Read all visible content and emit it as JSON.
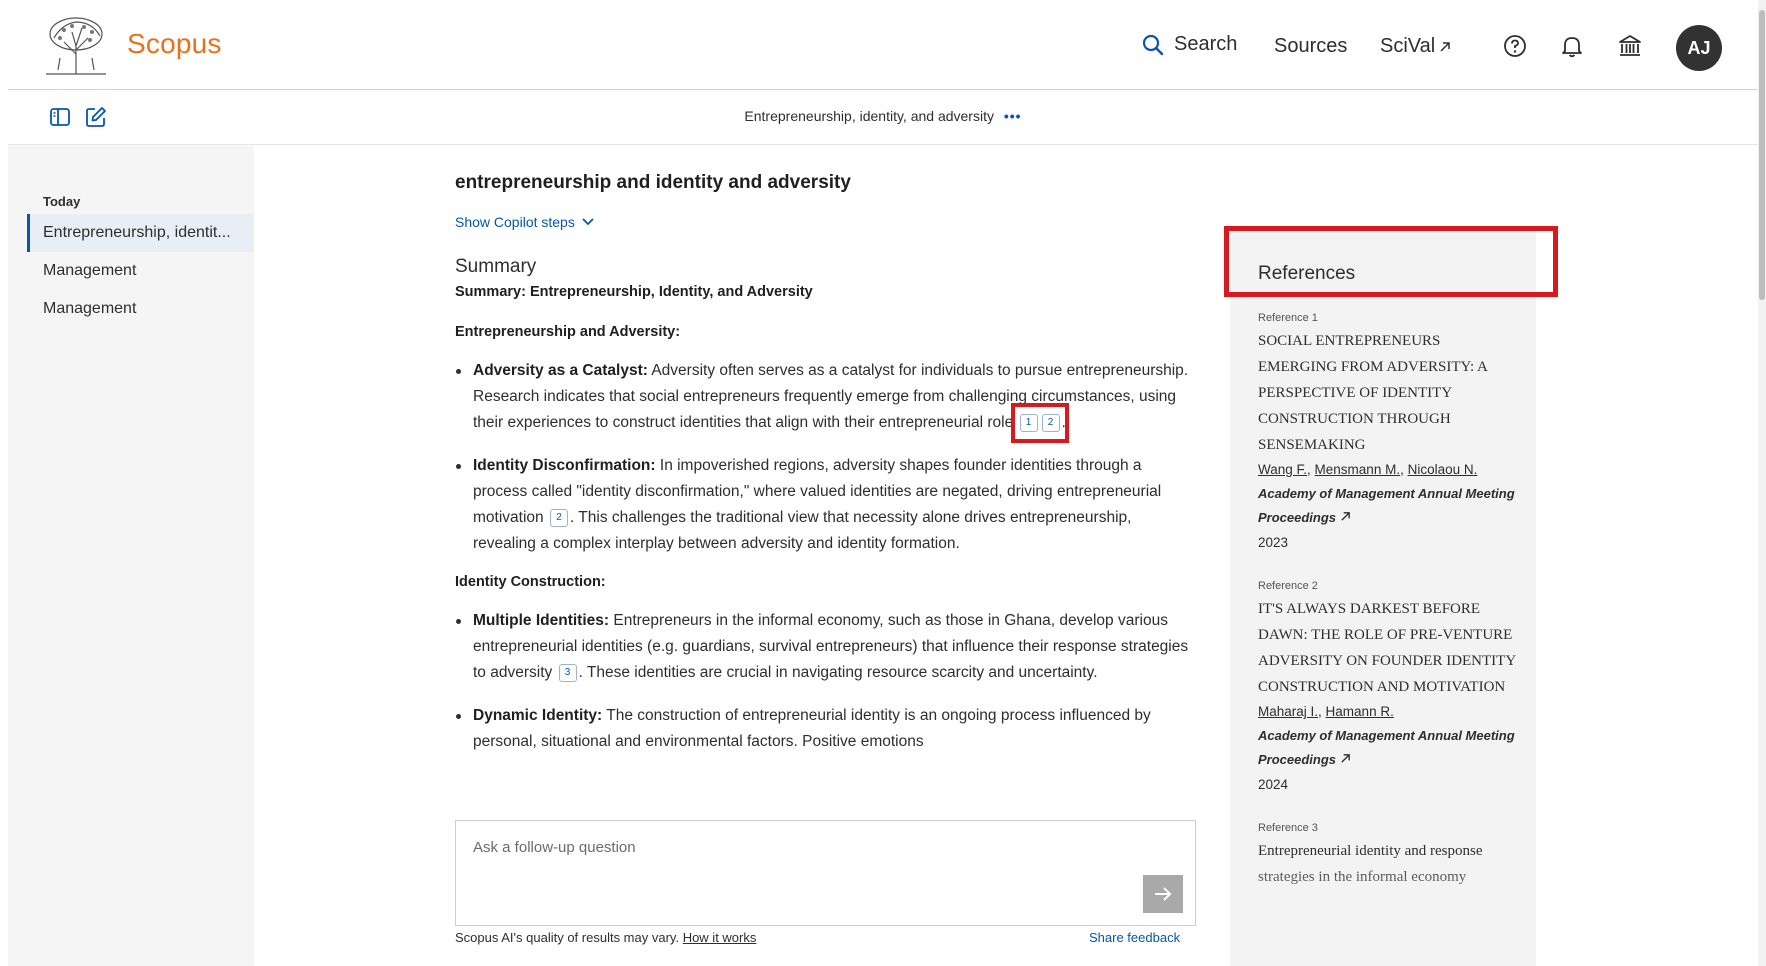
{
  "header": {
    "brand": "Scopus",
    "search_label": "Search",
    "sources_label": "Sources",
    "scival_label": "SciVal",
    "avatar_initials": "AJ"
  },
  "subheader": {
    "conversation_title": "Entrepreneurship, identity, and adversity",
    "more_label": "•••"
  },
  "sidebar": {
    "section_label": "Today",
    "items": [
      {
        "label": "Entrepreneurship, identit..."
      },
      {
        "label": "Management"
      },
      {
        "label": "Management"
      }
    ]
  },
  "main": {
    "query_title": "entrepreneurship and identity and adversity",
    "copilot_steps_label": "Show Copilot steps",
    "summary_heading": "Summary",
    "summary_subtitle": "Summary: Entrepreneurship, Identity, and Adversity",
    "section1_heading": "Entrepreneurship and Adversity:",
    "b1_term": "Adversity as a Catalyst:",
    "b1_text": " Adversity often serves as a catalyst for individuals to pursue entrepreneurship. Research indicates that social entrepreneurs frequently emerge from challenging circumstances, using their experiences to construct identities that align with their entrepreneurial role",
    "b1_cite1": "1",
    "b1_cite2": "2",
    "b1_end": ".",
    "b2_term": "Identity Disconfirmation:",
    "b2_text": " In impoverished regions, adversity shapes founder identities through a process called \"identity disconfirmation,\" where valued identities are negated, driving entrepreneurial motivation",
    "b2_cite": "2",
    "b2_end": ". This challenges the traditional view that necessity alone drives entrepreneurship, revealing a complex interplay between adversity and identity formation.",
    "section2_heading": "Identity Construction:",
    "b3_term": "Multiple Identities:",
    "b3_text": " Entrepreneurs in the informal economy, such as those in Ghana, develop various entrepreneurial identities (e.g. guardians, survival entrepreneurs) that influence their response strategies to adversity",
    "b3_cite": "3",
    "b3_end": ". These identities are crucial in navigating resource scarcity and uncertainty.",
    "b4_term": "Dynamic Identity:",
    "b4_text": " The construction of entrepreneurial identity is an ongoing process influenced by personal, situational and environmental factors. Positive emotions"
  },
  "followup": {
    "placeholder": "Ask a follow-up question",
    "disclaimer": "Scopus AI's quality of results may vary.",
    "how_it_works": "How it works",
    "share_feedback": "Share feedback"
  },
  "references": {
    "title": "References",
    "items": [
      {
        "label": "Reference 1",
        "title": "Social entrepreneurs emerging from adversity: A perspective of identity construction through sensemaking",
        "authors": [
          "Wang F.",
          "Mensmann M.",
          "Nicolaou N."
        ],
        "journal": "Academy of Management Annual Meeting Proceedings",
        "year": "2023"
      },
      {
        "label": "Reference 2",
        "title": "It's always darkest before dawn: The role of pre-venture adversity on founder identity construction and motivation",
        "authors": [
          "Maharaj I.",
          "Hamann R."
        ],
        "journal": "Academy of Management Annual Meeting Proceedings",
        "year": "2024"
      },
      {
        "label": "Reference 3",
        "title": "Entrepreneurial identity and response strategies in the informal economy"
      }
    ]
  }
}
